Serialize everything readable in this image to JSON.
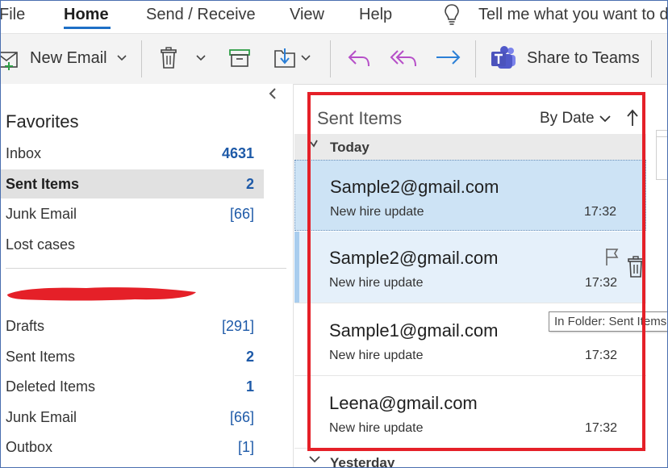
{
  "menu": {
    "file": "File",
    "home": "Home",
    "send_receive": "Send / Receive",
    "view": "View",
    "help": "Help",
    "tell_me": "Tell me what you want to d"
  },
  "ribbon": {
    "new_email": "New Email",
    "share_teams": "Share to Teams",
    "icons": [
      "new-email-icon",
      "delete-icon",
      "archive-icon",
      "move-icon",
      "reply-icon",
      "reply-all-icon",
      "forward-icon",
      "teams-icon"
    ],
    "colors": {
      "reply": "#b64fc8",
      "forward": "#2b7fd6",
      "teams": "#4b53bc",
      "new_email_plus": "#2e9e46"
    }
  },
  "folders": {
    "favorites_title": "Favorites",
    "favorites": [
      {
        "label": "Inbox",
        "count": "4631",
        "style": "bold"
      },
      {
        "label": "Sent Items",
        "count": "2",
        "style": "bold",
        "selected": true
      },
      {
        "label": "Junk Email",
        "count": "[66]",
        "style": "bracket"
      },
      {
        "label": "Lost cases",
        "count": "",
        "style": "none"
      }
    ],
    "account": [
      {
        "label": "Drafts",
        "count": "[291]",
        "style": "bracket"
      },
      {
        "label": "Sent Items",
        "count": "2",
        "style": "bold"
      },
      {
        "label": "Deleted Items",
        "count": "1",
        "style": "bold"
      },
      {
        "label": "Junk Email",
        "count": "[66]",
        "style": "bracket"
      },
      {
        "label": "Outbox",
        "count": "[1]",
        "style": "bracket"
      }
    ],
    "redaction_color": "#e52028"
  },
  "list": {
    "title": "Sent Items",
    "sort_label": "By Date",
    "groups": {
      "today": "Today",
      "yesterday": "Yesterday"
    },
    "messages": [
      {
        "from": "Sample2@gmail.com",
        "subject": "New hire update",
        "time": "17:32",
        "state": "selected"
      },
      {
        "from": "Sample2@gmail.com",
        "subject": "New hire update",
        "time": "17:32",
        "state": "hover"
      },
      {
        "from": "Sample1@gmail.com",
        "subject": "New hire update",
        "time": "17:32",
        "state": "normal"
      },
      {
        "from": "Leena@gmail.com",
        "subject": "New hire update",
        "time": "17:32",
        "state": "normal"
      }
    ],
    "tooltip": "In Folder: Sent Items"
  },
  "highlight_color": "#e52028"
}
